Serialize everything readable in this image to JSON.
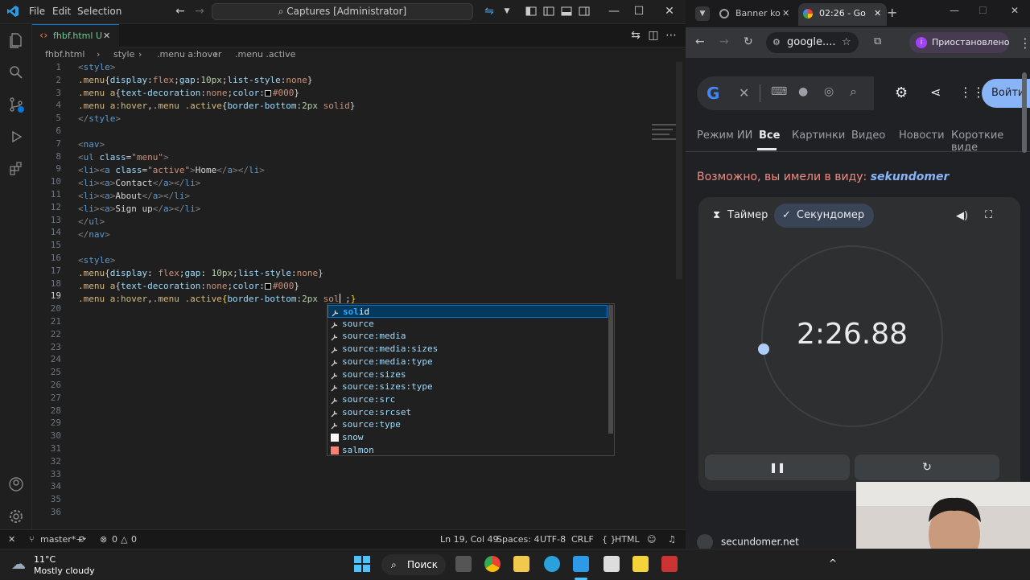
{
  "vscode": {
    "menu": [
      "File",
      "Edit",
      "Selection"
    ],
    "command_center": "Captures [Administrator]",
    "tab_label": "fhbf.html",
    "tab_badge": "U",
    "breadcrumb": [
      "fhbf.html",
      "style",
      ".menu a:hover",
      ".menu .active"
    ],
    "line_numbers": [
      "1",
      "2",
      "3",
      "4",
      "5",
      "6",
      "7",
      "8",
      "9",
      "10",
      "11",
      "12",
      "13",
      "14",
      "15",
      "16",
      "17",
      "18",
      "19",
      "20",
      "21",
      "22",
      "23",
      "24",
      "25",
      "26",
      "27",
      "28",
      "29",
      "30",
      "31",
      "32",
      "33",
      "34",
      "35",
      "36"
    ],
    "suggestions": [
      {
        "label": "solid",
        "kind": "value"
      },
      {
        "label": "source",
        "kind": "value"
      },
      {
        "label": "source:media",
        "kind": "value"
      },
      {
        "label": "source:media:sizes",
        "kind": "value"
      },
      {
        "label": "source:media:type",
        "kind": "value"
      },
      {
        "label": "source:sizes",
        "kind": "value"
      },
      {
        "label": "source:sizes:type",
        "kind": "value"
      },
      {
        "label": "source:src",
        "kind": "value"
      },
      {
        "label": "source:srcset",
        "kind": "value"
      },
      {
        "label": "source:type",
        "kind": "value"
      },
      {
        "label": "snow",
        "kind": "color",
        "color": "#fffafa"
      },
      {
        "label": "salmon",
        "kind": "color",
        "color": "#fa8072"
      }
    ],
    "status": {
      "branch": "master*+",
      "problems": "0",
      "warnings": "0",
      "position": "Ln 19, Col 49",
      "spaces": "Spaces: 4",
      "encoding": "UTF-8",
      "eol": "CRLF",
      "language": "HTML"
    }
  },
  "chrome": {
    "tabs": [
      "Banner ko",
      "02:26 - Go"
    ],
    "omnibox": "google....",
    "profile": "Приостановлено",
    "search_tabs": [
      "Режим ИИ",
      "Все",
      "Картинки",
      "Видео",
      "Новости",
      "Короткие виде"
    ],
    "login_button": "Войти",
    "did_you_mean": "Возможно, вы имели в виду:",
    "did_you_mean_term": "sekundomer",
    "timer_tab": "Таймер",
    "stopwatch_tab": "Секундомер",
    "elapsed": "2:26.88",
    "site": "secundomer.net"
  },
  "taskbar": {
    "temp": "11°C",
    "weather": "Mostly cloudy",
    "search": "Поиск"
  },
  "colors": {
    "accent": "#0078d4",
    "chrome_bg": "#202124"
  }
}
